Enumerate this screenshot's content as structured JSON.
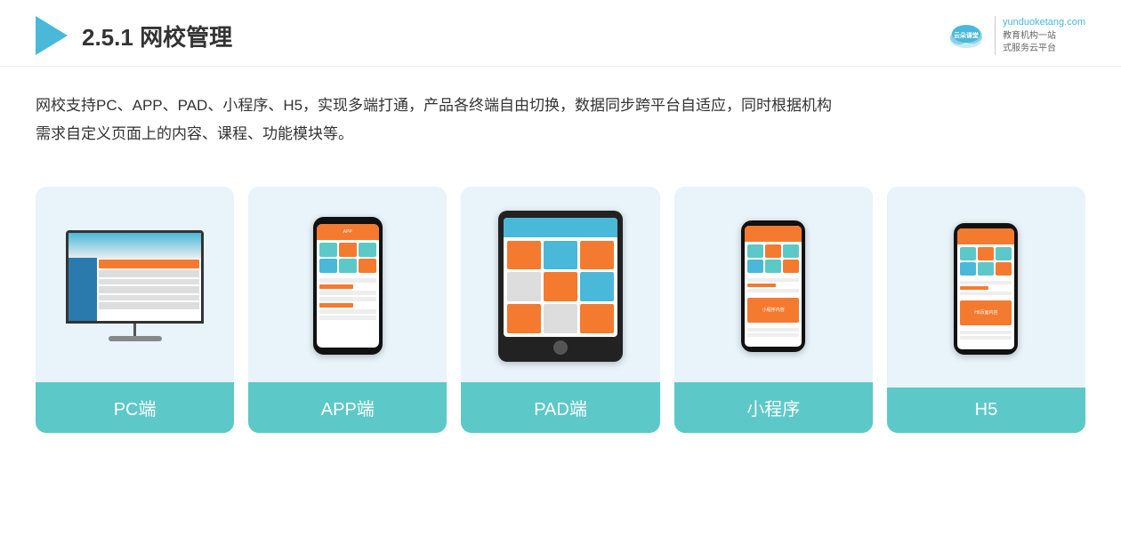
{
  "header": {
    "title_prefix": "2.5.1 ",
    "title_main": "网校管理",
    "brand_name": "云朵课堂",
    "brand_url": "yunduoketang.com",
    "brand_slogan": "教育机构一站\n式服务云平台"
  },
  "description": {
    "text_line1": "网校支持PC、APP、PAD、小程序、H5，实现多端打通，产品各终端自由切换，数据同步跨平台自适应，同时根据机构",
    "text_line2": "需求自定义页面上的内容、课程、功能模块等。"
  },
  "cards": [
    {
      "id": "pc",
      "label": "PC端"
    },
    {
      "id": "app",
      "label": "APP端"
    },
    {
      "id": "pad",
      "label": "PAD端"
    },
    {
      "id": "miniprogram",
      "label": "小程序"
    },
    {
      "id": "h5",
      "label": "H5"
    }
  ],
  "colors": {
    "teal": "#5dc8c8",
    "blue": "#4ab8d8",
    "orange": "#f47a30",
    "dark": "#111",
    "bg_card": "#e8f4fa"
  }
}
